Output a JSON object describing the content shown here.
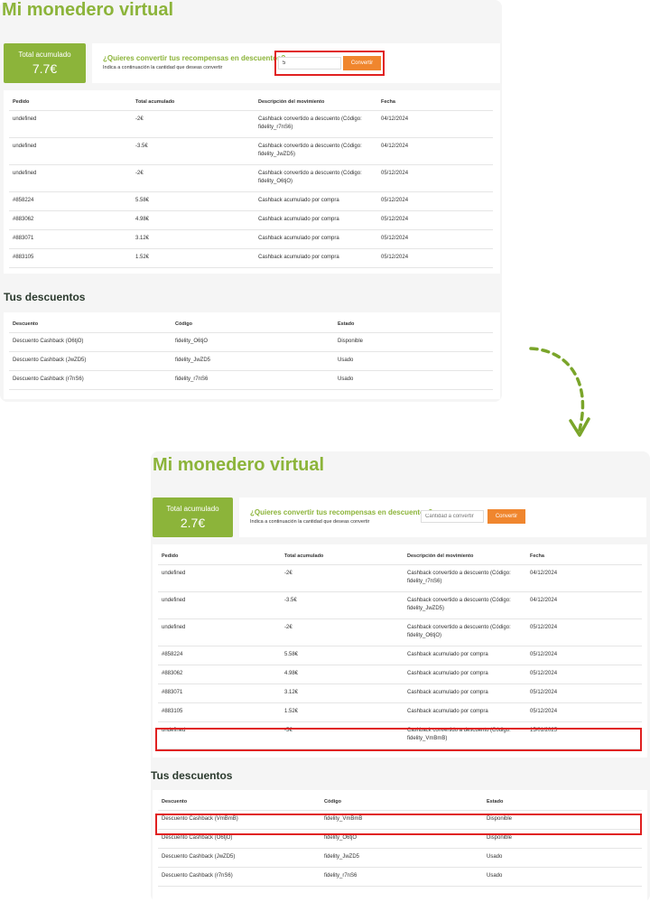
{
  "before": {
    "title": "Mi monedero virtual",
    "total_label": "Total acumulado",
    "total_value": "7.7€",
    "convert_question": "¿Quieres convertir tus recompensas en descuentos?",
    "convert_sub": "Indica a continuación la cantidad que deseas convertir",
    "input_value": "5",
    "convert_button": "Convertir",
    "movements_headers": [
      "Pedido",
      "Total acumulado",
      "Descripción del movimiento",
      "Fecha"
    ],
    "movements": [
      [
        "undefined",
        "-2€",
        "Cashback convertido a descuento (Código: fidelity_r7nS6)",
        "04/12/2024"
      ],
      [
        "undefined",
        "-3.5€",
        "Cashback convertido a descuento (Código: fidelity_JwZD5)",
        "04/12/2024"
      ],
      [
        "undefined",
        "-2€",
        "Cashback convertido a descuento (Código: fidelity_O6tjO)",
        "05/12/2024"
      ],
      [
        "#858224",
        "5.58€",
        "Cashback acumulado por compra",
        "05/12/2024"
      ],
      [
        "#883062",
        "4.98€",
        "Cashback acumulado por compra",
        "05/12/2024"
      ],
      [
        "#883071",
        "3.12€",
        "Cashback acumulado por compra",
        "05/12/2024"
      ],
      [
        "#883105",
        "1.52€",
        "Cashback acumulado por compra",
        "05/12/2024"
      ]
    ],
    "discounts_title": "Tus descuentos",
    "discounts_headers": [
      "Descuento",
      "Código",
      "Estado"
    ],
    "discounts": [
      [
        "Descuento Cashback (O6tjO)",
        "fidelity_O6tjO",
        "Disponible"
      ],
      [
        "Descuento Cashback (JwZD5)",
        "fidelity_JwZD5",
        "Usado"
      ],
      [
        "Descuento Cashback (r7nS6)",
        "fidelity_r7nS6",
        "Usado"
      ]
    ]
  },
  "after": {
    "title": "Mi monedero virtual",
    "total_label": "Total acumulado",
    "total_value": "2.7€",
    "convert_question": "¿Quieres convertir tus recompensas en descuentos?",
    "convert_sub": "Indica a continuación la cantidad que deseas convertir",
    "input_placeholder": "Cantidad a convertir",
    "convert_button": "Convertir",
    "movements_headers": [
      "Pedido",
      "Total acumulado",
      "Descripción del movimiento",
      "Fecha"
    ],
    "movements": [
      [
        "undefined",
        "-2€",
        "Cashback convertido a descuento (Código: fidelity_r7nS6)",
        "04/12/2024"
      ],
      [
        "undefined",
        "-3.5€",
        "Cashback convertido a descuento (Código: fidelity_JwZD5)",
        "04/12/2024"
      ],
      [
        "undefined",
        "-2€",
        "Cashback convertido a descuento (Código: fidelity_O6tjO)",
        "05/12/2024"
      ],
      [
        "#858224",
        "5.58€",
        "Cashback acumulado por compra",
        "05/12/2024"
      ],
      [
        "#883062",
        "4.98€",
        "Cashback acumulado por compra",
        "05/12/2024"
      ],
      [
        "#883071",
        "3.12€",
        "Cashback acumulado por compra",
        "05/12/2024"
      ],
      [
        "#883105",
        "1.52€",
        "Cashback acumulado por compra",
        "05/12/2024"
      ],
      [
        "undefined",
        "-5€",
        "Cashback convertido a descuento (Código: fidelity_VmBmB)",
        "15/01/2025"
      ]
    ],
    "discounts_title": "Tus descuentos",
    "discounts_headers": [
      "Descuento",
      "Código",
      "Estado"
    ],
    "discounts": [
      [
        "Descuento Cashback (VmBmB)",
        "fidelity_VmBmB",
        "Disponible"
      ],
      [
        "Descuento Cashback (O6tjO)",
        "fidelity_O6tjO",
        "Disponible"
      ],
      [
        "Descuento Cashback (JwZD5)",
        "fidelity_JwZD5",
        "Usado"
      ],
      [
        "Descuento Cashback (r7nS6)",
        "fidelity_r7nS6",
        "Usado"
      ]
    ]
  },
  "colors": {
    "brand_green": "#8cb43a",
    "convert_orange": "#f0862e",
    "highlight_red": "#e02020",
    "arrow_green": "#7aa52a"
  },
  "icons": {
    "arrow": "dashed-curved-arrow-icon"
  }
}
